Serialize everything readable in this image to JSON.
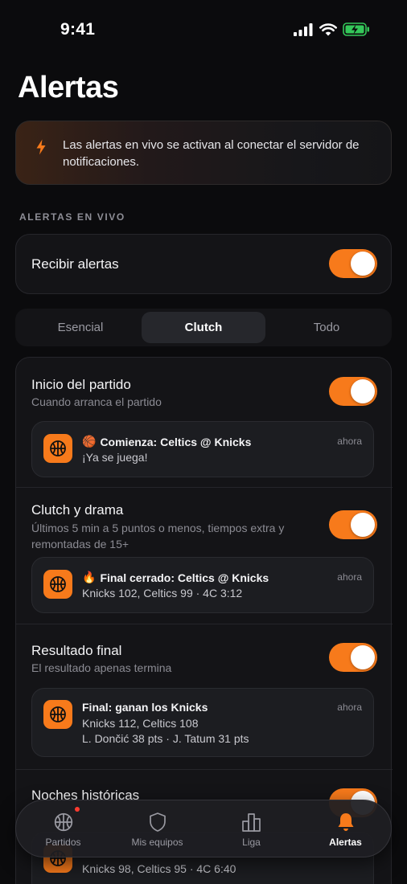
{
  "status_bar": {
    "time": "9:41"
  },
  "page": {
    "title": "Alertas"
  },
  "banner": {
    "text": "Las alertas en vivo se activan al conectar el servidor de notificaciones.",
    "icon": "bolt-icon"
  },
  "live_alerts": {
    "section_label": "ALERTAS EN VIVO",
    "receive_label": "Recibir alertas",
    "receive_enabled": true
  },
  "segments": {
    "options": [
      "Esencial",
      "Clutch",
      "Todo"
    ],
    "selected": "Clutch"
  },
  "alert_rows": [
    {
      "title": "Inicio del partido",
      "subtitle": "Cuando arranca el partido",
      "enabled": true,
      "preview": {
        "emoji": "🏀",
        "title": "Comienza: Celtics @ Knicks",
        "time": "ahora",
        "lines": [
          "¡Ya se juega!"
        ]
      }
    },
    {
      "title": "Clutch y drama",
      "subtitle": "Últimos 5 min a 5 puntos o menos, tiempos extra y remontadas de 15+",
      "enabled": true,
      "preview": {
        "emoji": "🔥",
        "title": "Final cerrado: Celtics @ Knicks",
        "time": "ahora",
        "lines": [
          "Knicks 102, Celtics 99 · 4C 3:12"
        ]
      }
    },
    {
      "title": "Resultado final",
      "subtitle": "El resultado apenas termina",
      "enabled": true,
      "preview": {
        "emoji": "",
        "title": "Final: ganan los Knicks",
        "time": "ahora",
        "lines": [
          "Knicks 112, Celtics 108",
          "L. Dončić 38 pts · J. Tatum 31 pts"
        ]
      }
    },
    {
      "title": "Noches históricas",
      "enabled": true,
      "preview": {
        "lines": [
          "Knicks 98, Celtics 95 · 4C 6:40"
        ]
      }
    }
  ],
  "tabbar": {
    "items": [
      {
        "label": "Partidos",
        "icon": "basketball-icon",
        "badge": true
      },
      {
        "label": "Mis equipos",
        "icon": "shield-icon"
      },
      {
        "label": "Liga",
        "icon": "bar-chart-icon"
      },
      {
        "label": "Alertas",
        "icon": "bell-icon",
        "active": true
      }
    ]
  },
  "colors": {
    "accent": "#f77a1b",
    "background": "#0b0b0d",
    "card": "#141417",
    "badge": "#ff3b30",
    "battery": "#34c759"
  }
}
